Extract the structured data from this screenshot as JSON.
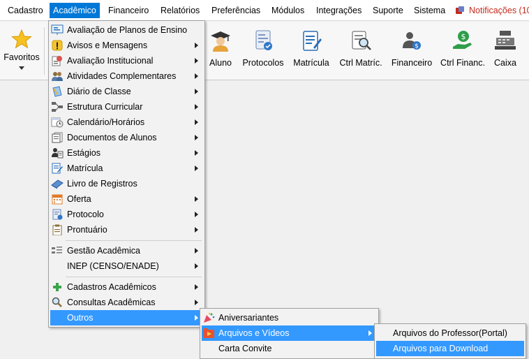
{
  "menubar": {
    "items": [
      "Cadastro",
      "Acadêmico",
      "Financeiro",
      "Relatórios",
      "Preferências",
      "Módulos",
      "Integrações",
      "Suporte",
      "Sistema"
    ],
    "notifications": "Notificações (10"
  },
  "toolbar": {
    "favorites": "Favoritos",
    "buttons": [
      "Aluno",
      "Protocolos",
      "Matrícula",
      "Ctrl Matríc.",
      "Financeiro",
      "Ctrl Financ.",
      "Caixa"
    ]
  },
  "academic_menu": {
    "items": [
      {
        "label": "Avaliação de Planos de Ensino",
        "icon": "presentation-board-icon",
        "submenu": false
      },
      {
        "label": "Avisos e Mensagens",
        "icon": "warning-icon",
        "submenu": true
      },
      {
        "label": "Avaliação Institucional",
        "icon": "evaluation-icon",
        "submenu": true
      },
      {
        "label": "Atividades Complementares",
        "icon": "people-icon",
        "submenu": true
      },
      {
        "label": "Diário de Classe",
        "icon": "diary-icon",
        "submenu": true
      },
      {
        "label": "Estrutura Curricular",
        "icon": "hierarchy-icon",
        "submenu": true
      },
      {
        "label": "Calendário/Horários",
        "icon": "calendar-clock-icon",
        "submenu": true
      },
      {
        "label": "Documentos de Alunos",
        "icon": "documents-icon",
        "submenu": true
      },
      {
        "label": "Estágios",
        "icon": "internship-icon",
        "submenu": true
      },
      {
        "label": "Matrícula",
        "icon": "enrollment-icon",
        "submenu": true
      },
      {
        "label": "Livro de Registros",
        "icon": "book-icon",
        "submenu": false
      },
      {
        "label": "Oferta",
        "icon": "offer-calendar-icon",
        "submenu": true
      },
      {
        "label": "Protocolo",
        "icon": "protocol-icon",
        "submenu": true
      },
      {
        "label": "Prontuário",
        "icon": "clipboard-icon",
        "submenu": true
      },
      {
        "label": "Gestão Acadêmica",
        "icon": "management-icon",
        "submenu": true
      },
      {
        "label": "INEP (CENSO/ENADE)",
        "icon": "",
        "submenu": true
      },
      {
        "label": "Cadastros Acadêmicos",
        "icon": "plus-icon",
        "submenu": true
      },
      {
        "label": "Consultas Acadêmicas",
        "icon": "magnifier-icon",
        "submenu": true
      },
      {
        "label": "Outros",
        "icon": "",
        "submenu": true
      }
    ]
  },
  "outros_menu": {
    "items": [
      {
        "label": "Aniversariantes",
        "icon": "party-icon",
        "submenu": false
      },
      {
        "label": "Arquivos e Vídeos",
        "icon": "media-folder-icon",
        "submenu": true
      },
      {
        "label": "Carta Convite",
        "icon": "",
        "submenu": false
      }
    ]
  },
  "files_menu": {
    "items": [
      {
        "label": "Arquivos do Professor(Portal)"
      },
      {
        "label": "Arquivos para Download"
      }
    ]
  },
  "colors": {
    "highlight": "#3399ff",
    "menubar_active": "#0078d7",
    "notification": "#c42b1c"
  }
}
